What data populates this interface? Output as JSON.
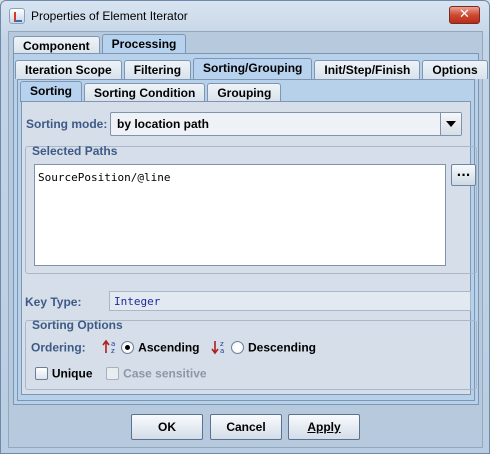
{
  "window": {
    "title": "Properties of Element Iterator",
    "close_glyph": "✕",
    "icon": "java-app-icon"
  },
  "tabs_top": [
    {
      "label": "Component",
      "selected": false
    },
    {
      "label": "Processing",
      "selected": true
    }
  ],
  "tabs_mid": [
    {
      "label": "Iteration Scope",
      "selected": false
    },
    {
      "label": "Filtering",
      "selected": false
    },
    {
      "label": "Sorting/Grouping",
      "selected": true
    },
    {
      "label": "Init/Step/Finish",
      "selected": false
    },
    {
      "label": "Options",
      "selected": false
    }
  ],
  "tabs_sub": [
    {
      "label": "Sorting",
      "selected": true
    },
    {
      "label": "Sorting Condition",
      "selected": false
    },
    {
      "label": "Grouping",
      "selected": false
    }
  ],
  "sorting": {
    "mode_label": "Sorting mode:",
    "mode_value": "by location path",
    "selected_paths_title": "Selected Paths",
    "paths_text": "SourcePosition/@line",
    "browse_label": "...",
    "key_type_label": "Key Type:",
    "key_type_value": "Integer",
    "options_title": "Sorting Options",
    "ordering_label": "Ordering:",
    "ascending_label": "Ascending",
    "descending_label": "Descending",
    "ascending_checked": true,
    "descending_checked": false,
    "unique_label": "Unique",
    "unique_checked": false,
    "case_sensitive_label": "Case sensitive",
    "case_sensitive_enabled": false
  },
  "buttons": {
    "ok": "OK",
    "cancel": "Cancel",
    "apply": "Apply"
  },
  "colors": {
    "label_blue": "#3d5a87",
    "key_type_text": "#1e2b9c",
    "close_red": "#cf4a32"
  }
}
